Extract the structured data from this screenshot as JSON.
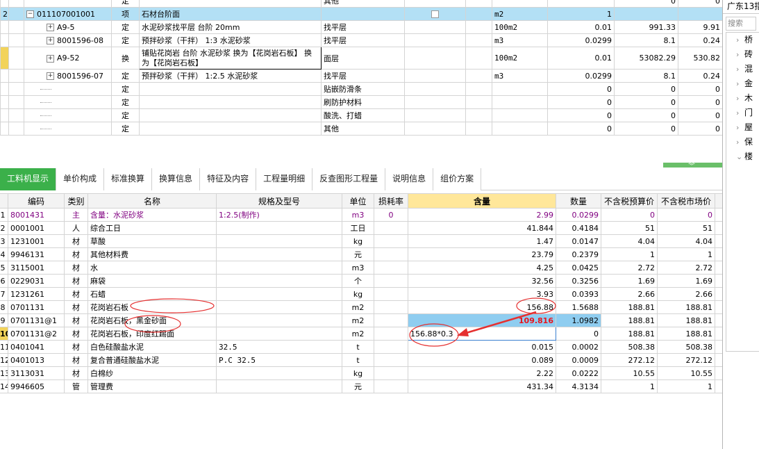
{
  "top_rows": [
    {
      "code": "",
      "type": "定",
      "name": "",
      "feature": "其他",
      "unit": "",
      "qty": "",
      "p1": "0",
      "p2": "0"
    },
    {
      "rownum": "2",
      "code": "011107001001",
      "toggle": "−",
      "type": "项",
      "name": "石材台阶面",
      "feature": "",
      "unit": "m2",
      "qty": "1",
      "p1": "",
      "p2": ""
    },
    {
      "code": "A9-5",
      "toggle": "+",
      "type": "定",
      "name": "水泥砂浆找平层 台阶 20mm",
      "feature": "找平层",
      "unit": "100m2",
      "qty": "0.01",
      "p1": "991.33",
      "p2": "9.91"
    },
    {
      "code": "8001596-08",
      "toggle": "+",
      "type": "定",
      "name": "预拌砂浆（干拌） 1:3 水泥砂浆",
      "feature": "找平层",
      "unit": "m3",
      "qty": "0.0299",
      "p1": "8.1",
      "p2": "0.24"
    },
    {
      "code": "A9-52",
      "toggle": "+",
      "type": "换",
      "name": "铺贴花岗岩 台阶 水泥砂浆  换为【花岗岩石板】  换为【花岗岩石板】",
      "feature": "面层",
      "unit": "100m2",
      "qty": "0.01",
      "p1": "53082.29",
      "p2": "530.82"
    },
    {
      "code": "8001596-07",
      "toggle": "+",
      "type": "定",
      "name": "预拌砂浆（干拌） 1:2.5 水泥砂浆",
      "feature": "找平层",
      "unit": "m3",
      "qty": "0.0299",
      "p1": "8.1",
      "p2": "0.24"
    },
    {
      "code": "",
      "type": "定",
      "name": "",
      "feature": "贴嵌防滑条",
      "unit": "",
      "qty": "0",
      "p1": "0",
      "p2": "0"
    },
    {
      "code": "",
      "type": "定",
      "name": "",
      "feature": "刷防护材料",
      "unit": "",
      "qty": "0",
      "p1": "0",
      "p2": "0"
    },
    {
      "code": "",
      "type": "定",
      "name": "",
      "feature": "酸洗、打蜡",
      "unit": "",
      "qty": "0",
      "p1": "0",
      "p2": "0"
    },
    {
      "code": "",
      "type": "定",
      "name": "",
      "feature": "其他",
      "unit": "",
      "qty": "0",
      "p1": "0",
      "p2": "0"
    }
  ],
  "tabs": [
    "工料机显示",
    "单价构成",
    "标准换算",
    "换算信息",
    "特征及内容",
    "工程量明细",
    "反查图形工程量",
    "说明信息",
    "组价方案"
  ],
  "columns": [
    "编码",
    "类别",
    "名称",
    "规格及型号",
    "单位",
    "损耗率",
    "含量",
    "数量",
    "不含税预算价",
    "不含税市场价"
  ],
  "rows": [
    {
      "n": "1",
      "code": "8001431",
      "cat": "主",
      "name": "含量：水泥砂浆",
      "spec": "1:2.5(制作)",
      "unit": "m3",
      "loss": "0",
      "content": "2.99",
      "qty": "0.0299",
      "budget": "0",
      "market": "0"
    },
    {
      "n": "2",
      "code": "0001001",
      "cat": "人",
      "name": "综合工日",
      "spec": "",
      "unit": "工日",
      "loss": "",
      "content": "41.844",
      "qty": "0.4184",
      "budget": "51",
      "market": "51"
    },
    {
      "n": "3",
      "code": "1231001",
      "cat": "材",
      "name": "草酸",
      "spec": "",
      "unit": "kg",
      "loss": "",
      "content": "1.47",
      "qty": "0.0147",
      "budget": "4.04",
      "market": "4.04"
    },
    {
      "n": "4",
      "code": "9946131",
      "cat": "材",
      "name": "其他材料费",
      "spec": "",
      "unit": "元",
      "loss": "",
      "content": "23.79",
      "qty": "0.2379",
      "budget": "1",
      "market": "1"
    },
    {
      "n": "5",
      "code": "3115001",
      "cat": "材",
      "name": "水",
      "spec": "",
      "unit": "m3",
      "loss": "",
      "content": "4.25",
      "qty": "0.0425",
      "budget": "2.72",
      "market": "2.72"
    },
    {
      "n": "6",
      "code": "0229031",
      "cat": "材",
      "name": "麻袋",
      "spec": "",
      "unit": "个",
      "loss": "",
      "content": "32.56",
      "qty": "0.3256",
      "budget": "1.69",
      "market": "1.69"
    },
    {
      "n": "7",
      "code": "1231261",
      "cat": "材",
      "name": "石蜡",
      "spec": "",
      "unit": "kg",
      "loss": "",
      "content": "3.93",
      "qty": "0.0393",
      "budget": "2.66",
      "market": "2.66"
    },
    {
      "n": "8",
      "code": "0701131",
      "cat": "材",
      "name": "花岗岩石板",
      "spec": "",
      "unit": "m2",
      "loss": "",
      "content": "156.88",
      "qty": "1.5688",
      "budget": "188.81",
      "market": "188.81"
    },
    {
      "n": "9",
      "code": "0701131@1",
      "cat": "材",
      "name": "花岗岩石板，黑金砂面",
      "spec": "",
      "unit": "m2",
      "loss": "",
      "content": "109.816",
      "qty": "1.0982",
      "budget": "188.81",
      "market": "188.81"
    },
    {
      "n": "10",
      "code": "0701131@2",
      "cat": "材",
      "name": "花岗岩石板，印度红踢面",
      "spec": "",
      "unit": "m2",
      "loss": "",
      "content": "156.88*0.3",
      "qty": "0",
      "budget": "188.81",
      "market": "188.81"
    },
    {
      "n": "11",
      "code": "0401041",
      "cat": "材",
      "name": "白色硅酸盐水泥",
      "spec": "32.5",
      "unit": "t",
      "loss": "",
      "content": "0.015",
      "qty": "0.0002",
      "budget": "508.38",
      "market": "508.38"
    },
    {
      "n": "12",
      "code": "0401013",
      "cat": "材",
      "name": "复合普通硅酸盐水泥",
      "spec": "P.C 32.5",
      "unit": "t",
      "loss": "",
      "content": "0.089",
      "qty": "0.0009",
      "budget": "272.12",
      "market": "272.12"
    },
    {
      "n": "13",
      "code": "3113031",
      "cat": "材",
      "name": "白棉纱",
      "spec": "",
      "unit": "kg",
      "loss": "",
      "content": "2.22",
      "qty": "0.0222",
      "budget": "10.55",
      "market": "10.55"
    },
    {
      "n": "14",
      "code": "9946605",
      "cat": "管",
      "name": "管理费",
      "spec": "",
      "unit": "元",
      "loss": "",
      "content": "431.34",
      "qty": "4.3134",
      "budget": "1",
      "market": "1"
    }
  ],
  "right_panel": {
    "title": "广东13指",
    "search_placeholder": "搜索",
    "items": [
      "桥",
      "砖",
      "混",
      "金",
      "木",
      "门",
      "屋",
      "保",
      "楼"
    ]
  }
}
